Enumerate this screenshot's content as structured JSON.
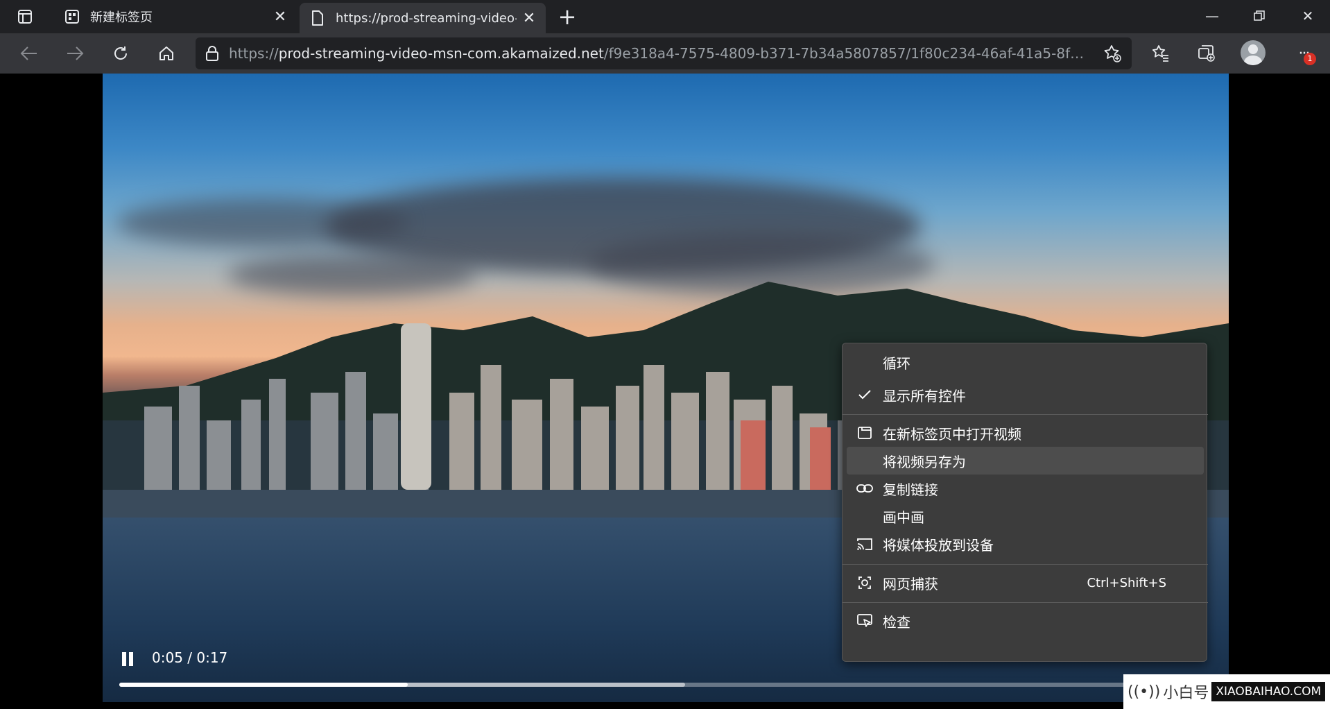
{
  "tabs": [
    {
      "title": "新建标签页",
      "active": false,
      "icon": "newtab-page-icon"
    },
    {
      "title": "https://prod-streaming-video-m",
      "active": true,
      "icon": "document-icon"
    }
  ],
  "address_bar": {
    "url_prefix": "https://",
    "url_host": "prod-streaming-video-msn-com.akamaized.net",
    "url_path": "/f9e318a4-7575-4809-b371-7b34a5807857/1f80c234-46af-41a5-8f50-8f09..."
  },
  "toolbar": {
    "notification_count": "1"
  },
  "video": {
    "time": "0:05 / 0:17",
    "played_fraction": 0.26,
    "buffered_fraction": 0.51
  },
  "context_menu": {
    "items": [
      {
        "label": "循环",
        "icon": "",
        "checked": false
      },
      {
        "label": "显示所有控件",
        "icon": "check-icon",
        "checked": true
      },
      {
        "label": "在新标签页中打开视频",
        "icon": "open-tab-icon"
      },
      {
        "label": "将视频另存为",
        "icon": "",
        "hover": true
      },
      {
        "label": "复制链接",
        "icon": "link-icon"
      },
      {
        "label": "画中画",
        "icon": ""
      },
      {
        "label": "将媒体投放到设备",
        "icon": "cast-icon"
      },
      {
        "label": "网页捕获",
        "icon": "web-capture-icon",
        "shortcut": "Ctrl+Shift+S"
      },
      {
        "label": "检查",
        "icon": "inspect-icon"
      }
    ]
  },
  "watermark": {
    "brand": "小白号",
    "site": "XIAOBAIHAO.COM"
  }
}
